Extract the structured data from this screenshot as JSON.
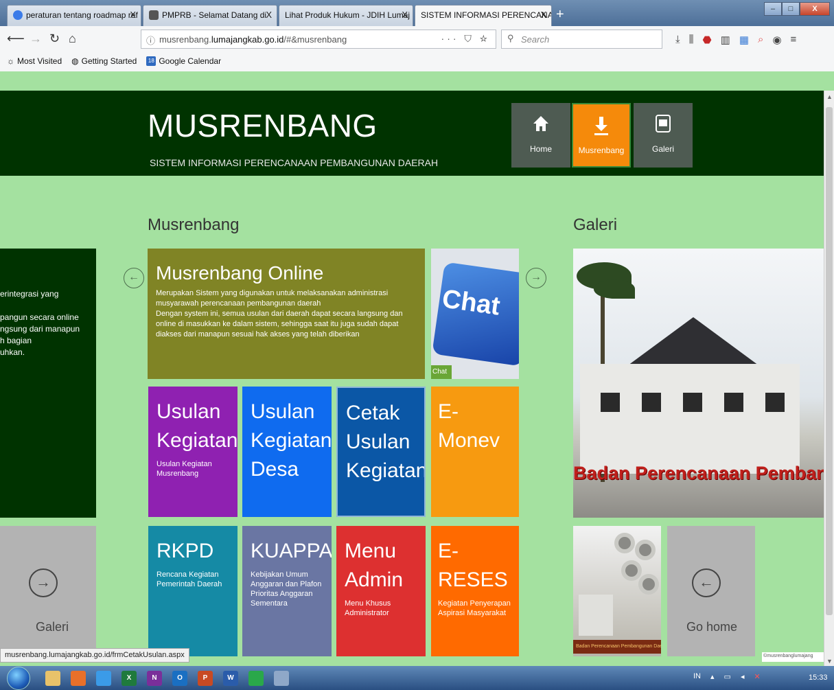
{
  "browser": {
    "tabs": [
      {
        "label": "peraturan tentang roadmap ref",
        "favicon_color": "#3b7be8"
      },
      {
        "label": "PMPRB - Selamat Datang di",
        "favicon_color": "#555555"
      },
      {
        "label": "Lihat Produk Hukum - JDIH Lumaj",
        "favicon_color": "#ffffff"
      },
      {
        "label": "SISTEM INFORMASI PERENCANAAN",
        "favicon_color": "#ffffff"
      }
    ],
    "tab_close": "X",
    "new_tab": "+",
    "window_controls": {
      "minimize": "–",
      "maximize": "□",
      "close": "X"
    },
    "url_prefix": "musrenbang.",
    "url_domain": "lumajangkab.go.id",
    "url_suffix": "/#&musrenbang",
    "url_actions": "··· ⛉ ☆",
    "search_placeholder": "Search",
    "bookmarks": [
      "Most Visited",
      "Getting Started",
      "Google Calendar"
    ],
    "gcal_badge": "18"
  },
  "site": {
    "title": "MUSRENBANG",
    "subtitle": "SISTEM INFORMASI PERENCANAAN PEMBANGUNAN DAERAH",
    "nav": [
      {
        "label": "Home",
        "icon": "home-icon"
      },
      {
        "label": "Musrenbang",
        "icon": "download-icon"
      },
      {
        "label": "Galeri",
        "icon": "gallery-icon"
      }
    ]
  },
  "sections": {
    "left": "Musrenbang",
    "right": "Galeri"
  },
  "left_partial": {
    "lines": [
      "erintegrasi yang",
      "",
      "pangun secara online",
      "ngsung dari manapun",
      "h bagian",
      "uhkan."
    ],
    "galeri_label": "Galeri"
  },
  "tiles": {
    "online": {
      "title": "Musrenbang Online",
      "desc_1": "Merupakan Sistem yang digunakan untuk melaksanakan administrasi musyarawah perencanaan pembangunan daerah",
      "desc_2": "Dengan system ini, semua usulan dari daerah dapat secara langsung dan online di masukkan ke dalam sistem, sehingga saat itu juga sudah dapat diakses dari manapun sesuai hak akses yang telah diberikan"
    },
    "chat": {
      "word": "Chat",
      "label": "Chat"
    },
    "usulan": {
      "title": "Usulan Kegiatan",
      "sub": "Usulan Kegiatan Musrenbang"
    },
    "desa": {
      "title": "Usulan Kegiatan Desa"
    },
    "cetak": {
      "title": "Cetak Usulan Kegiatan"
    },
    "emonev": {
      "title": "E-Monev"
    },
    "rkpd": {
      "title": "RKPD",
      "sub": "Rencana Kegiatan Pemerintah Daerah"
    },
    "kuappas": {
      "title": "KUAPPAS",
      "sub": "Kebijakan Umum Anggaran dan Plafon Prioritas Anggaran Sementara"
    },
    "admin": {
      "title": "Menu Admin",
      "sub": "Menu Khusus Administrator"
    },
    "ereses": {
      "title": "E-RESES",
      "sub": "Kegiatan Penyerapan Aspirasi Masyarakat"
    }
  },
  "gallery": {
    "main_caption": "Badan Perencanaan Pembangunan",
    "thumb_caption": "Badan Perencanaan Pembangunan Daerah Kabupaten Lumajang",
    "gohome_label": "Go home",
    "copyright": "©musrenbanglumajang"
  },
  "status_url": "musrenbang.lumajangkab.go.id/frmCetakUsulan.aspx",
  "taskbar": {
    "apps": [
      {
        "label": "",
        "color": "#e8c26a"
      },
      {
        "label": "",
        "color": "#e8702a"
      },
      {
        "label": "",
        "color": "#3b9be8"
      },
      {
        "label": "X",
        "color": "#1f7a3c"
      },
      {
        "label": "N",
        "color": "#7a2f9a"
      },
      {
        "label": "O",
        "color": "#1a6fc2"
      },
      {
        "label": "P",
        "color": "#c84a23"
      },
      {
        "label": "W",
        "color": "#2a5caa"
      },
      {
        "label": "",
        "color": "#2aa84a"
      },
      {
        "label": "",
        "color": "#8fa8c8"
      }
    ],
    "lang": "IN",
    "clock": "15:33"
  }
}
